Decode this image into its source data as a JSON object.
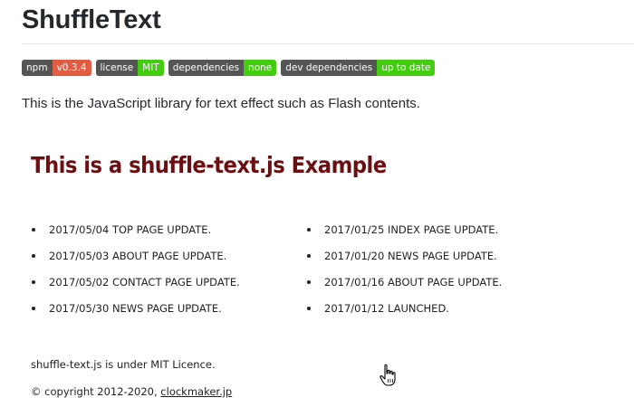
{
  "page": {
    "title": "ShuffleText",
    "description": "This is the JavaScript library for text effect such as Flash contents."
  },
  "badges": [
    {
      "label": "npm",
      "value": "v0.3.4",
      "color": "#e05d44"
    },
    {
      "label": "license",
      "value": "MIT",
      "color": "#4c1"
    },
    {
      "label": "dependencies",
      "value": "none",
      "color": "#4c1"
    },
    {
      "label": "dev dependencies",
      "value": "up to date",
      "color": "#4c1"
    }
  ],
  "example": {
    "heading": "This is a shuffle-text.js Example",
    "heading_color": "#6b0f12",
    "left_items": [
      "2017/05/04 TOP PAGE UPDATE.",
      "2017/05/03 ABOUT PAGE UPDATE.",
      "2017/05/02 CONTACT PAGE UPDATE.",
      "2017/05/30 NEWS PAGE UPDATE."
    ],
    "right_items": [
      "2017/01/25 INDEX PAGE UPDATE.",
      "2017/01/20 NEWS PAGE UPDATE.",
      "2017/01/16 ABOUT PAGE UPDATE.",
      "2017/01/12 LAUNCHED."
    ],
    "licence_note": "shuffle-text.js is under MIT Licence.",
    "copyright_prefix": "© copyright 2012-2020, ",
    "copyright_link": "clockmaker.jp"
  },
  "cursor": {
    "icon": "hand-pointer-icon"
  }
}
